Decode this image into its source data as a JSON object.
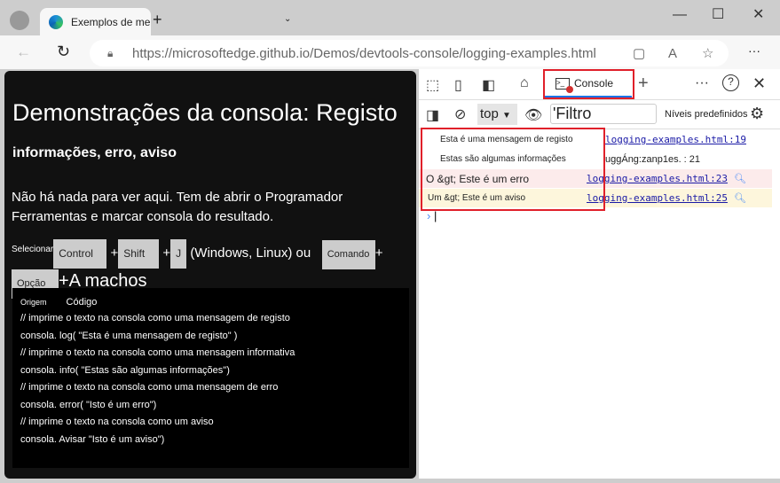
{
  "browser": {
    "tab_title": "Exemplos de mensagens da consola:Registo",
    "url_host": "https://microsoftedge.github.io",
    "url_path": "/Demos/devtools-console/logging-examples.html"
  },
  "page": {
    "title": "Demonstrações da consola: Registo",
    "subtitle": "informações, erro, aviso",
    "intro": "Não há nada para ver aqui. Tem de abrir o Programador Ferramentas e marcar consola do resultado.",
    "select": "Selecionar",
    "keys": [
      "Control",
      "Shift",
      "J",
      "Comando",
      "Opção"
    ],
    "plus": "+",
    "os_text": "(Windows, Linux) ou",
    "mac_text": "+A machos",
    "code_headers": [
      "Origem",
      "Código"
    ],
    "code_lines": [
      "//  imprime o texto na consola como uma mensagem de registo",
      "consola. log( \"Esta é uma mensagem de registo\" )",
      "//  imprime o texto na consola como uma mensagem informativa",
      "consola. info( \"Estas são algumas informações\")",
      "//  imprime o texto na consola como uma mensagem de erro",
      "consola. error( \"Isto é um erro\")",
      "//  imprime o texto na consola como um aviso",
      "consola. Avisar \"Isto é um aviso\")"
    ]
  },
  "devtools": {
    "console_tab": "Console",
    "context": "top",
    "filter": "'Filtro",
    "levels": "Níveis predefinidos",
    "messages": [
      {
        "text": "Esta é uma mensagem de registo",
        "source": "logging-examples.html:19",
        "level": "log"
      },
      {
        "text": "Estas são algumas informações",
        "source": "uggÁng:zanp1es. : 21",
        "level": "info"
      },
      {
        "text": "O &gt; Este é um erro",
        "source": "logging-examples.html:23",
        "level": "error"
      },
      {
        "text": "Um &gt; Este é um aviso",
        "source": "logging-examples.html:25",
        "level": "warning"
      }
    ]
  }
}
